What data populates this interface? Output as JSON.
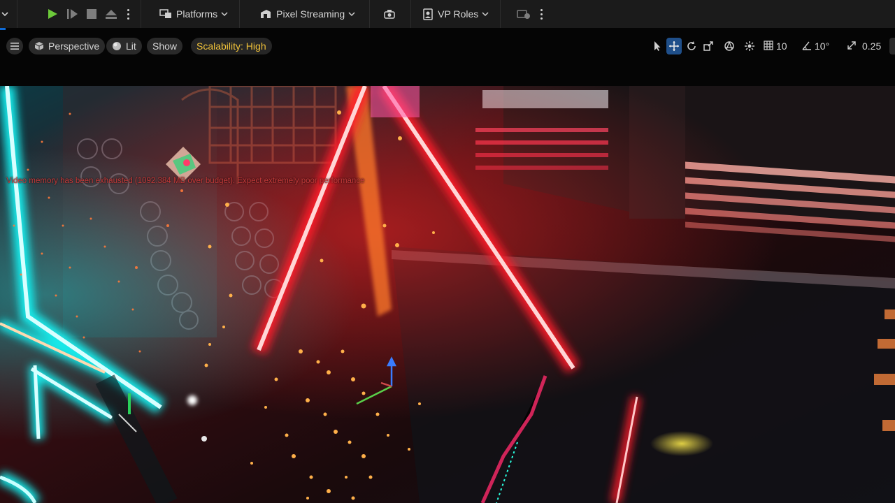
{
  "toolbar": {
    "platforms_label": "Platforms",
    "pixel_streaming_label": "Pixel Streaming",
    "vp_roles_label": "VP Roles"
  },
  "viewport": {
    "view_mode": "Perspective",
    "lighting_mode": "Lit",
    "show_label": "Show",
    "scalability_label": "Scalability: High",
    "grid_snap_value": "10",
    "rotation_snap_value": "10°",
    "scale_snap_value": "0.25"
  },
  "scene": {
    "warning_text": "Video memory has been exhausted (1092.384 MB over budget). Expect extremely poor performance"
  },
  "colors": {
    "accent_blue": "#1f4f8a",
    "play_green": "#6cc93a",
    "scalability_yellow": "#f0c23a",
    "warning_red": "#c53a3a"
  },
  "icons": {
    "play": "play-icon",
    "step": "step-forward-icon",
    "stop": "stop-icon",
    "eject": "eject-icon",
    "platforms": "platforms-icon",
    "pixel_streaming": "pixel-streaming-icon",
    "vp_roles": "vp-roles-icon"
  }
}
